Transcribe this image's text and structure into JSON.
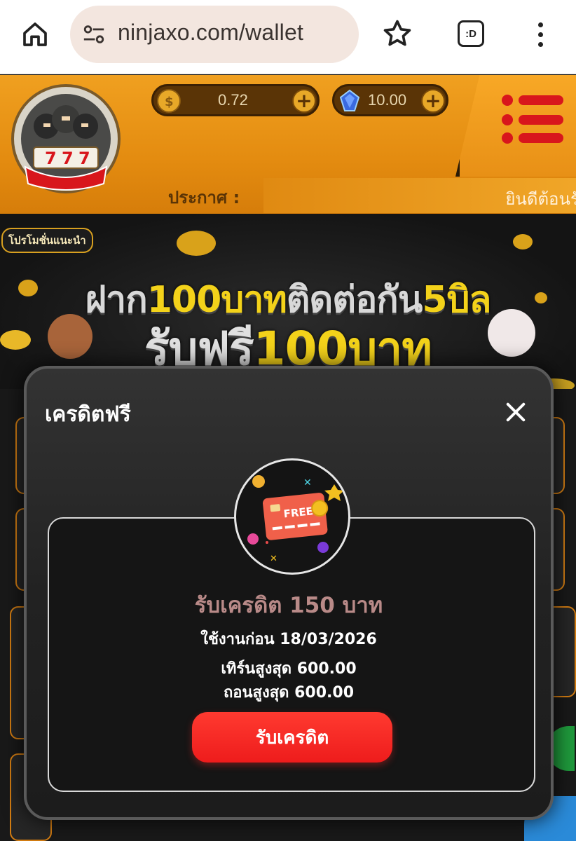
{
  "browser": {
    "url": "ninjaxo.com/wallet",
    "tab_icon_text": ":D"
  },
  "header": {
    "coin_balance": "0.72",
    "gem_balance": "10.00",
    "announcement_label": "ประกาศ :",
    "announcement_text": "ยินดีต้อนรับ"
  },
  "banner": {
    "tag": "โปรโมชั่นแนะนำ",
    "line1_a": "ฝาก",
    "line1_b": "100บาท",
    "line1_c": "ติดต่อกัน",
    "line1_d": "5บิล",
    "line2_a": "รับฟรี",
    "line2_b": "100บาท"
  },
  "modal": {
    "title": "เครดิตฟรี",
    "badge_text": "FREE",
    "credit_amount": "รับเครดิต 150 บาท",
    "expire": "ใช้งานก่อน 18/03/2026",
    "max_turnover": "เทิร์นสูงสุด 600.00",
    "max_withdraw": "ถอนสูงสุด 600.00",
    "claim_button": "รับเครดิต"
  },
  "colors": {
    "header_orange": "#f0a020",
    "menu_red": "#d8161c",
    "claim_red": "#ee1c1c",
    "banner_gold": "#f3d21a"
  },
  "icons": [
    "home-icon",
    "site-info-icon",
    "star-icon",
    "tab-switcher-icon",
    "more-vert-icon",
    "coin-icon",
    "gem-icon",
    "plus-icon",
    "menu-icon",
    "close-icon"
  ]
}
